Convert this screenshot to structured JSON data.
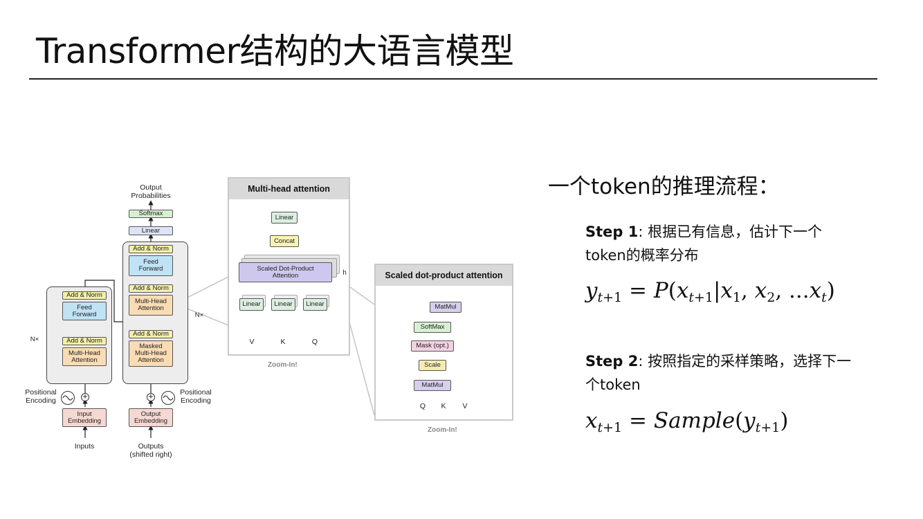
{
  "title": "Transformer结构的大语言模型",
  "diagram": {
    "main": {
      "output_probabilities": "Output\nProbabilities",
      "softmax": "Softmax",
      "linear": "Linear",
      "add_norm": "Add & Norm",
      "feed_forward": "Feed\nForward",
      "multi_head_attention": "Multi-Head\nAttention",
      "masked_multi_head_attention": "Masked\nMulti-Head\nAttention",
      "nx": "N×",
      "positional_encoding": "Positional\nEncoding",
      "input_embedding": "Input\nEmbedding",
      "output_embedding": "Output\nEmbedding",
      "inputs": "Inputs",
      "outputs": "Outputs\n(shifted right)"
    },
    "multi_head_panel": {
      "header": "Multi-head attention",
      "linear_top": "Linear",
      "concat": "Concat",
      "sdpa": "Scaled Dot-Product\nAttention",
      "h": "h",
      "linear": "Linear",
      "inputs": [
        "V",
        "K",
        "Q"
      ],
      "zoom": "Zoom-In!"
    },
    "scaled_panel": {
      "header": "Scaled dot-product attention",
      "matmul_top": "MatMul",
      "softmax": "SoftMax",
      "mask": "Mask (opt.)",
      "scale": "Scale",
      "matmul_bottom": "MatMul",
      "inputs": [
        "Q",
        "K",
        "V"
      ],
      "zoom": "Zoom-In!"
    }
  },
  "right": {
    "heading": "一个token的推理流程：",
    "step1_label": "Step 1",
    "step1_text": ": 根据已有信息，估计下一个token的概率分布",
    "step2_label": "Step 2",
    "step2_text": ": 按照指定的采样策略，选择下一个token"
  }
}
